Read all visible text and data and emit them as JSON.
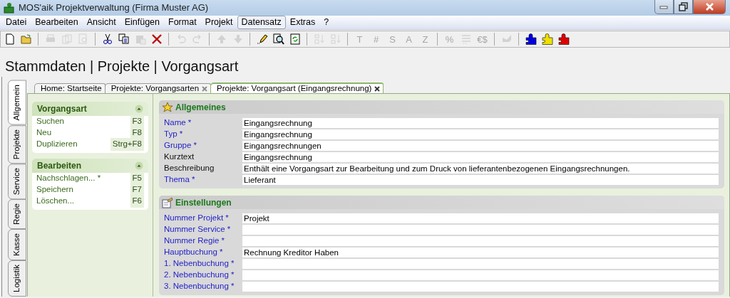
{
  "window": {
    "title": "MOS'aik Projektverwaltung (Firma Muster AG)"
  },
  "menu": [
    {
      "label": "Datei",
      "selected": false
    },
    {
      "label": "Bearbeiten",
      "selected": false
    },
    {
      "label": "Ansicht",
      "selected": false
    },
    {
      "label": "Einfügen",
      "selected": false
    },
    {
      "label": "Format",
      "selected": false
    },
    {
      "label": "Projekt",
      "selected": false
    },
    {
      "label": "Datensatz",
      "selected": true
    },
    {
      "label": "Extras",
      "selected": false
    },
    {
      "label": "?",
      "selected": false
    }
  ],
  "toolbar": [
    {
      "kind": "new",
      "disabled": false
    },
    {
      "kind": "open",
      "disabled": false
    },
    {
      "kind": "separator"
    },
    {
      "kind": "print",
      "disabled": true
    },
    {
      "kind": "pages",
      "disabled": true
    },
    {
      "kind": "preview",
      "disabled": true
    },
    {
      "kind": "separator"
    },
    {
      "kind": "cut",
      "disabled": false
    },
    {
      "kind": "copy",
      "disabled": false
    },
    {
      "kind": "paste",
      "disabled": true
    },
    {
      "kind": "delete",
      "disabled": false
    },
    {
      "kind": "separator"
    },
    {
      "kind": "undo",
      "disabled": true
    },
    {
      "kind": "redo",
      "disabled": true
    },
    {
      "kind": "separator"
    },
    {
      "kind": "up",
      "disabled": true
    },
    {
      "kind": "down",
      "disabled": true
    },
    {
      "kind": "separator"
    },
    {
      "kind": "pencil",
      "disabled": false
    },
    {
      "kind": "find",
      "disabled": false
    },
    {
      "kind": "refresh",
      "disabled": false
    },
    {
      "kind": "separator"
    },
    {
      "kind": "sortup",
      "disabled": true
    },
    {
      "kind": "sortdown",
      "disabled": true
    },
    {
      "kind": "separator"
    },
    {
      "kind": "glyph",
      "label": "T",
      "disabled": true
    },
    {
      "kind": "glyph",
      "label": "#",
      "disabled": true
    },
    {
      "kind": "glyph",
      "label": "S",
      "disabled": true
    },
    {
      "kind": "glyph",
      "label": "A",
      "disabled": true
    },
    {
      "kind": "glyph",
      "label": "Z",
      "disabled": true
    },
    {
      "kind": "separator"
    },
    {
      "kind": "glyph",
      "label": "%",
      "disabled": true
    },
    {
      "kind": "numbering",
      "disabled": true
    },
    {
      "kind": "glyph",
      "label": "€$",
      "disabled": true
    },
    {
      "kind": "separator"
    },
    {
      "kind": "tool",
      "disabled": true
    },
    {
      "kind": "separator"
    },
    {
      "kind": "puzzle",
      "color": "#0000e0",
      "disabled": false
    },
    {
      "kind": "puzzle",
      "color": "#f0e000",
      "disabled": false
    },
    {
      "kind": "puzzle",
      "color": "#e00000",
      "disabled": false
    }
  ],
  "heading": "Stammdaten | Projekte | Vorgangsart",
  "side_tabs": [
    {
      "label": "Allgemein",
      "selected": true
    },
    {
      "label": "Projekte",
      "selected": false
    },
    {
      "label": "Service",
      "selected": false
    },
    {
      "label": "Regie",
      "selected": false
    },
    {
      "label": "Kasse",
      "selected": false
    },
    {
      "label": "Logistik",
      "selected": false
    }
  ],
  "tabs": [
    {
      "label": "Home: Startseite",
      "closable": false,
      "selected": false
    },
    {
      "label": "Projekte: Vorgangsarten",
      "closable": true,
      "selected": false
    },
    {
      "label": "Projekte: Vorgangsart (Eingangsrechnung)",
      "closable": true,
      "selected": true
    }
  ],
  "task_panels": [
    {
      "title": "Vorgangsart",
      "expanded": true,
      "items": [
        {
          "label": "Suchen",
          "key": "F3"
        },
        {
          "label": "Neu",
          "key": "F8"
        },
        {
          "label": "Duplizieren",
          "key": "Strg+F8"
        }
      ]
    },
    {
      "title": "Bearbeiten",
      "expanded": true,
      "items": [
        {
          "label": "Nachschlagen... *",
          "key": "F5"
        },
        {
          "label": "Speichern",
          "key": "F7"
        },
        {
          "label": "Löschen...",
          "key": "F6"
        }
      ]
    }
  ],
  "sections": [
    {
      "title": "Allgemeines",
      "fields": [
        {
          "label": "Name *",
          "required": true,
          "value": "Eingangsrechnung"
        },
        {
          "label": "Typ *",
          "required": true,
          "value": "Eingangsrechnung"
        },
        {
          "label": "Gruppe *",
          "required": true,
          "value": "Eingangsrechnungen"
        },
        {
          "label": "Kurztext",
          "required": false,
          "value": "Eingangsrechnung"
        },
        {
          "label": "Beschreibung",
          "required": false,
          "value": "Enthält eine Vorgangsart zur Bearbeitung und zum Druck von lieferantenbezogenen Eingangsrechnungen."
        },
        {
          "label": "Thema *",
          "required": true,
          "value": "Lieferant"
        }
      ]
    },
    {
      "title": "Einstellungen",
      "fields": [
        {
          "label": "Nummer Projekt *",
          "required": true,
          "value": "Projekt"
        },
        {
          "label": "Nummer Service *",
          "required": true
        },
        {
          "label": "Nummer Regie *",
          "required": true
        },
        {
          "label": "Hauptbuchung *",
          "required": true,
          "value": "Rechnung Kreditor Haben"
        },
        {
          "label": "1. Nebenbuchung *",
          "required": true
        },
        {
          "label": "2. Nebenbuchung *",
          "required": true
        },
        {
          "label": "3. Nebenbuchung *",
          "required": true
        }
      ]
    }
  ]
}
